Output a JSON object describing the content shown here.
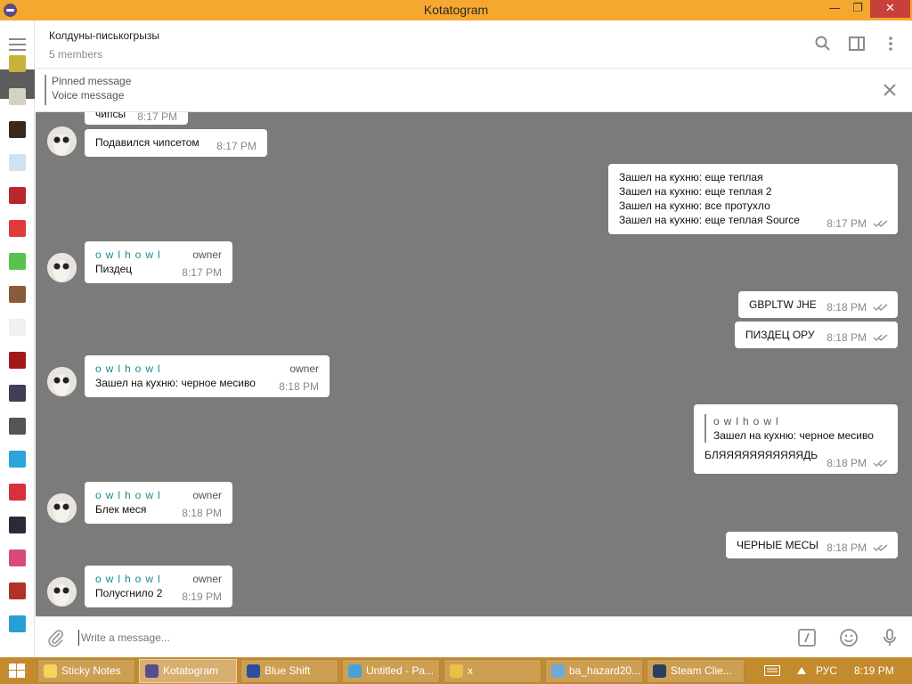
{
  "window": {
    "title": "Kotatogram",
    "min": "—",
    "max": "❐",
    "close": "✕"
  },
  "header": {
    "chat_title": "Колдуны-писькогрызы",
    "members": "5 members"
  },
  "pinned": {
    "label": "Pinned message",
    "sub": "Voice message"
  },
  "messages": [
    {
      "id": "m0",
      "dir": "in",
      "lines": [
        "чипсы"
      ],
      "time": "8:17 PM"
    },
    {
      "id": "m1",
      "dir": "in",
      "lines": [
        "Подавился чипсетом"
      ],
      "time": "8:17 PM"
    },
    {
      "id": "m2",
      "dir": "out",
      "lines": [
        "Зашел на кухню: еще теплая",
        "Зашел на кухню: еще теплая 2",
        "Зашел на кухню: все протухло",
        "Зашел на кухню: еще теплая Source"
      ],
      "time": "8:17 PM"
    },
    {
      "id": "m3",
      "dir": "in",
      "author": "owlhowl",
      "role": "owner",
      "lines": [
        "Пиздец"
      ],
      "time": "8:17 PM"
    },
    {
      "id": "m4",
      "dir": "out",
      "lines": [
        "GBPLTW JHE"
      ],
      "time": "8:18 PM"
    },
    {
      "id": "m5",
      "dir": "out",
      "lines": [
        "ПИЗДЕЦ ОРУ"
      ],
      "time": "8:18 PM"
    },
    {
      "id": "m6",
      "dir": "in",
      "author": "owlhowl",
      "role": "owner",
      "lines": [
        "Зашел на кухню: черное месиво"
      ],
      "time": "8:18 PM"
    },
    {
      "id": "m7",
      "dir": "out",
      "reply_author": "owlhowl",
      "reply_text": "Зашел на кухню: черное месиво",
      "lines": [
        "БЛЯЯЯЯЯЯЯЯЯЯЯДЬ"
      ],
      "time": "8:18 PM"
    },
    {
      "id": "m8",
      "dir": "in",
      "author": "owlhowl",
      "role": "owner",
      "lines": [
        "Блек меся"
      ],
      "time": "8:18 PM"
    },
    {
      "id": "m9",
      "dir": "out",
      "lines": [
        "ЧЕРНЫЕ МЕСЫ"
      ],
      "time": "8:18 PM"
    },
    {
      "id": "m10",
      "dir": "in",
      "author": "owlhowl",
      "role": "owner",
      "lines": [
        "Полусгнило 2"
      ],
      "time": "8:19 PM"
    }
  ],
  "composer": {
    "placeholder": "Write a message..."
  },
  "taskbar": {
    "tasks": [
      {
        "label": "Sticky Notes",
        "icon_color": "#f6d35b"
      },
      {
        "label": "Kotatogram",
        "icon_color": "#5b4b8a"
      },
      {
        "label": "Blue Shift",
        "icon_color": "#2b4f9e"
      },
      {
        "label": "Untitled - Pa...",
        "icon_color": "#4aa0d8"
      },
      {
        "label": "x",
        "icon_color": "#e8c14a"
      },
      {
        "label": "ba_hazard20...",
        "icon_color": "#6fa8dc"
      },
      {
        "label": "Steam Clie...",
        "icon_color": "#2a3f5f"
      }
    ],
    "lang": "РУС",
    "clock": "8:19 PM"
  },
  "sidebar_chats": [
    {
      "icon": "chat-avatar-1",
      "color": "#c8b23a"
    },
    {
      "icon": "chat-avatar-2",
      "color": "#d6d1c4"
    },
    {
      "icon": "chat-avatar-3",
      "color": "#3a2a1e"
    },
    {
      "icon": "chat-avatar-4",
      "color": "#cfe2f0"
    },
    {
      "icon": "chat-avatar-5",
      "color": "#b8282b"
    },
    {
      "icon": "chat-avatar-6",
      "color": "#e03a3a"
    },
    {
      "icon": "chat-avatar-7",
      "color": "#59c24c"
    },
    {
      "icon": "chat-avatar-8",
      "color": "#8a5a3c"
    },
    {
      "icon": "chat-avatar-9",
      "color": "#f0f0f0"
    },
    {
      "icon": "chat-avatar-10",
      "color": "#a11a1a"
    },
    {
      "icon": "chat-avatar-11",
      "color": "#3f3f55"
    },
    {
      "icon": "chat-avatar-12",
      "color": "#555555"
    },
    {
      "icon": "chat-avatar-13",
      "color": "#2ea3dc"
    },
    {
      "icon": "chat-avatar-14",
      "color": "#d9303d"
    },
    {
      "icon": "chat-avatar-15",
      "color": "#2a2a3a"
    },
    {
      "icon": "chat-avatar-16",
      "color": "#d84a7a"
    },
    {
      "icon": "chat-avatar-17",
      "color": "#b0322a"
    },
    {
      "icon": "chat-avatar-18",
      "color": "#2a9fd6"
    }
  ]
}
